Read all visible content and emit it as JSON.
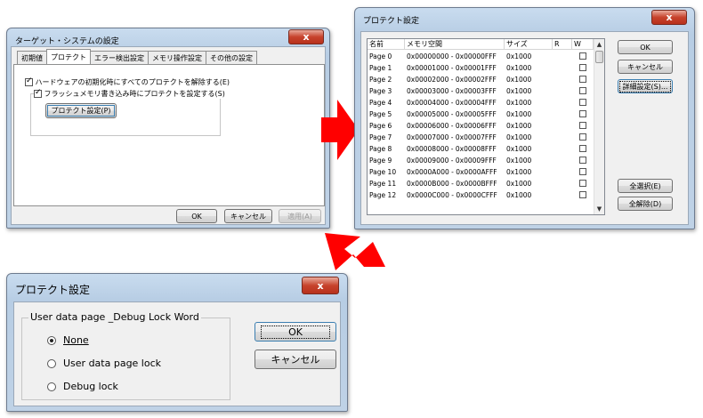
{
  "windows": {
    "target_system": {
      "title": "ターゲット・システムの設定",
      "close_label": "x",
      "tabs": [
        "初期値",
        "プロテクト",
        "エラー検出設定",
        "メモリ操作設定",
        "その他の設定"
      ],
      "active_tab": 1,
      "option1_label": "ハードウェアの初期化時にすべてのプロテクトを解除する(E)",
      "option2_label": "フラッシュメモリ書き込み時にプロテクトを設定する(S)",
      "protect_settings_button": "プロテクト設定(P)",
      "ok_button": "OK",
      "cancel_button": "キャンセル",
      "apply_button": "適用(A)"
    },
    "protect_list": {
      "title": "プロテクト設定",
      "close_label": "x",
      "columns": [
        "名前",
        "メモリ空間",
        "サイズ",
        "R",
        "W"
      ],
      "rows": [
        {
          "name": "Page 0",
          "range": "0x00000000 - 0x00000FFF",
          "size": "0x1000"
        },
        {
          "name": "Page 1",
          "range": "0x00001000 - 0x00001FFF",
          "size": "0x1000"
        },
        {
          "name": "Page 2",
          "range": "0x00002000 - 0x00002FFF",
          "size": "0x1000"
        },
        {
          "name": "Page 3",
          "range": "0x00003000 - 0x00003FFF",
          "size": "0x1000"
        },
        {
          "name": "Page 4",
          "range": "0x00004000 - 0x00004FFF",
          "size": "0x1000"
        },
        {
          "name": "Page 5",
          "range": "0x00005000 - 0x00005FFF",
          "size": "0x1000"
        },
        {
          "name": "Page 6",
          "range": "0x00006000 - 0x00006FFF",
          "size": "0x1000"
        },
        {
          "name": "Page 7",
          "range": "0x00007000 - 0x00007FFF",
          "size": "0x1000"
        },
        {
          "name": "Page 8",
          "range": "0x00008000 - 0x00008FFF",
          "size": "0x1000"
        },
        {
          "name": "Page 9",
          "range": "0x00009000 - 0x00009FFF",
          "size": "0x1000"
        },
        {
          "name": "Page 10",
          "range": "0x0000A000 - 0x0000AFFF",
          "size": "0x1000"
        },
        {
          "name": "Page 11",
          "range": "0x0000B000 - 0x0000BFFF",
          "size": "0x1000"
        },
        {
          "name": "Page 12",
          "range": "0x0000C000 - 0x0000CFFF",
          "size": "0x1000"
        }
      ],
      "ok_button": "OK",
      "cancel_button": "キャンセル",
      "detail_button": "詳細設定(S)...",
      "select_all_button": "全選択(E)",
      "deselect_all_button": "全解除(D)"
    },
    "debug_lock": {
      "title": "プロテクト設定",
      "close_label": "x",
      "group_label": "User data page _Debug Lock Word",
      "options": [
        "None",
        "User data page lock",
        "Debug lock"
      ],
      "selected_option": 0,
      "ok_button": "OK",
      "cancel_button": "キャンセル"
    }
  },
  "colors": {
    "arrow": "#ff0000",
    "close_button": "#c7432c",
    "title_glass": "#bfd2e6"
  }
}
